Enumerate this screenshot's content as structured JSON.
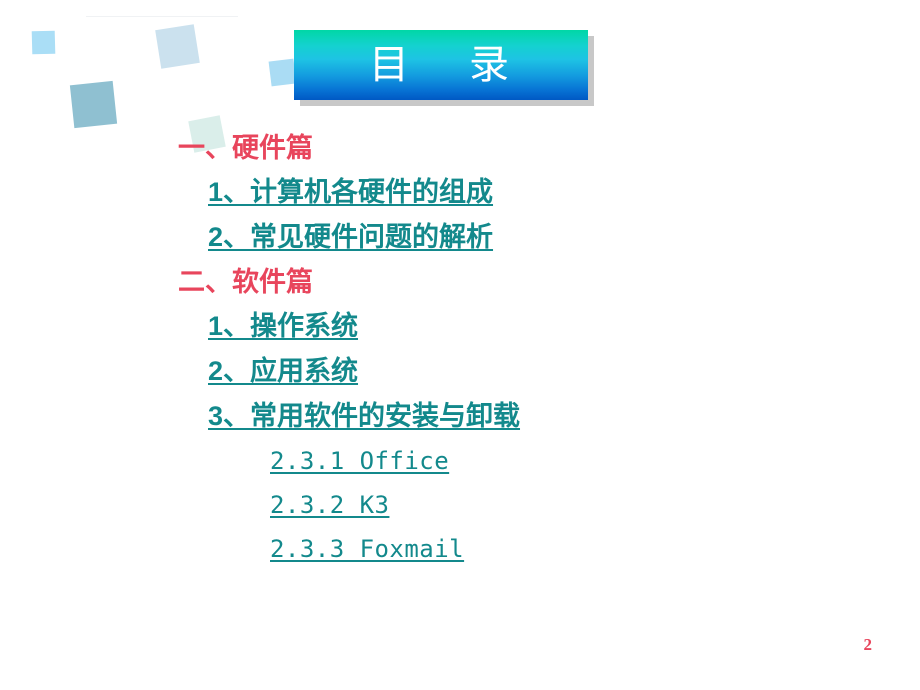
{
  "slide": {
    "background_color": "#ffffff",
    "page_number": "2",
    "page_number_color": "#e8455c"
  },
  "banner": {
    "title": "目    录",
    "gradient_top_color": "#00d7a6",
    "gradient_bottom_color": "#0058c4",
    "text_color": "#ffffff",
    "shadow_color": "#c8c8c8"
  },
  "colors": {
    "heading_red": "#e8455c",
    "link_teal": "#13898c",
    "deco_light_blue": "#aadef6",
    "deco_powder_blue": "#cbe1ee",
    "deco_teal_blue": "#8fc0d1",
    "deco_mint": "#daeeea"
  },
  "toc": {
    "items": [
      {
        "level": 1,
        "text": "一、硬件篇"
      },
      {
        "level": 2,
        "text": "1、计算机各硬件的组成"
      },
      {
        "level": 2,
        "text": "2、常见硬件问题的解析"
      },
      {
        "level": 1,
        "text": "二、软件篇"
      },
      {
        "level": 2,
        "text": "1、操作系统"
      },
      {
        "level": 2,
        "text": "2、应用系统"
      },
      {
        "level": 2,
        "text": "3、常用软件的安装与卸载"
      },
      {
        "level": 3,
        "text": "2.3.1 Office"
      },
      {
        "level": 3,
        "text": "2.3.2 K3"
      },
      {
        "level": 3,
        "text": "2.3.3 Foxmail"
      }
    ]
  },
  "decorations": [
    {
      "name": "square-small-blue"
    },
    {
      "name": "square-powder-blue"
    },
    {
      "name": "square-large-teal"
    },
    {
      "name": "square-behind-banner"
    },
    {
      "name": "square-mint"
    },
    {
      "name": "hairline"
    }
  ]
}
